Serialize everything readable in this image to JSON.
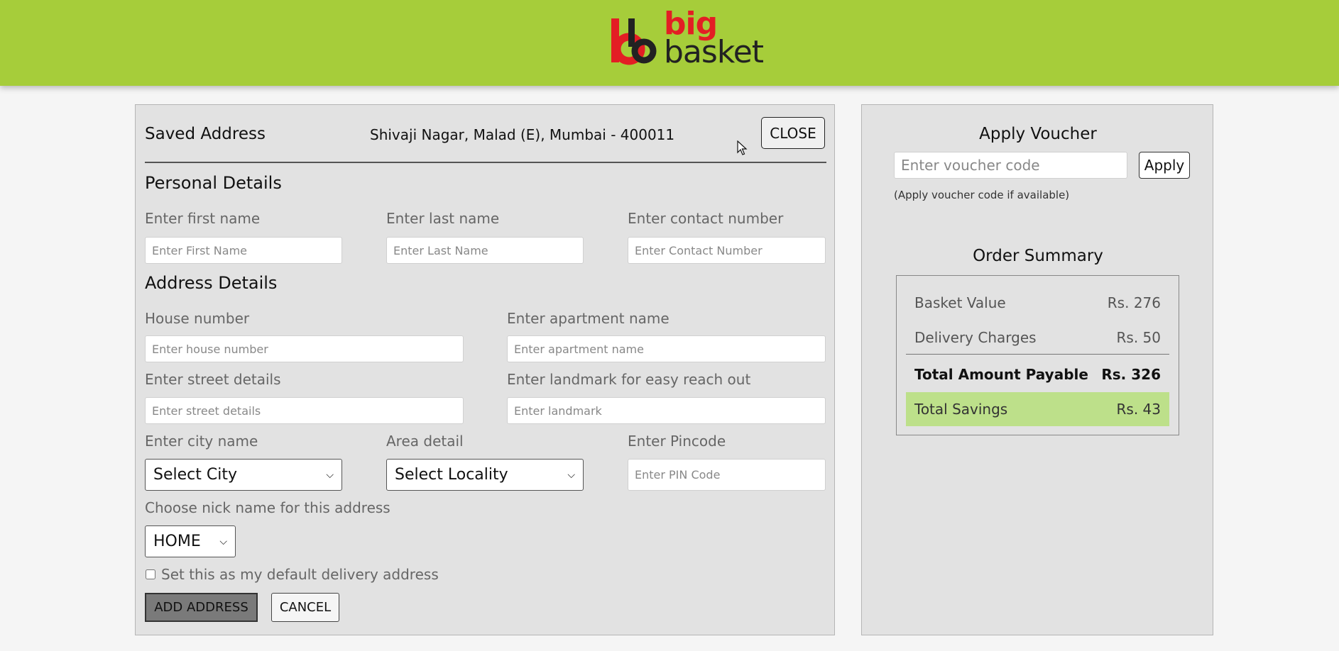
{
  "brand": {
    "logo_line1": "big",
    "logo_line2": "basket",
    "brand_red": "#e31e24",
    "header_color": "#a6cd3a"
  },
  "saved_address": {
    "heading": "Saved Address",
    "address": "Shivaji Nagar, Malad (E), Mumbai - 400011",
    "close_label": "CLOSE"
  },
  "personal": {
    "heading": "Personal Details",
    "first_name_label": "Enter first name",
    "first_name_placeholder": "Enter First Name",
    "last_name_label": "Enter last name",
    "last_name_placeholder": "Enter Last Name",
    "contact_label": "Enter contact number",
    "contact_placeholder": "Enter Contact Number"
  },
  "address": {
    "heading": "Address Details",
    "house_label": "House number",
    "house_placeholder": "Enter house number",
    "apartment_label": "Enter apartment name",
    "apartment_placeholder": "Enter apartment name",
    "street_label": "Enter street details",
    "street_placeholder": "Enter street details",
    "landmark_label": "Enter landmark for easy reach out",
    "landmark_placeholder": "Enter landmark",
    "city_label": "Enter city name",
    "city_selected": "Select City",
    "area_label": "Area detail",
    "area_selected": "Select Locality",
    "pincode_label": "Enter Pincode",
    "pincode_placeholder": "Enter PIN Code",
    "nickname_label": "Choose nick name for this address",
    "nickname_selected": "HOME",
    "default_checkbox_label": "Set this as my default delivery address",
    "default_checked": false,
    "add_label": "ADD ADDRESS",
    "cancel_label": "CANCEL"
  },
  "voucher": {
    "heading": "Apply Voucher",
    "placeholder": "Enter voucher code",
    "apply_label": "Apply",
    "note": "(Apply voucher code if available)"
  },
  "order_summary": {
    "heading": "Order Summary",
    "rows": [
      {
        "label": "Basket Value",
        "value": "Rs. 276"
      },
      {
        "label": "Delivery Charges",
        "value": "Rs. 50"
      }
    ],
    "total": {
      "label": "Total Amount Payable",
      "value": "Rs. 326"
    },
    "savings": {
      "label": "Total Savings",
      "value": "Rs. 43",
      "color": "#bde08a"
    }
  },
  "icons": {
    "dropdown": "chevron-down-icon",
    "cursor": "mouse-pointer-icon"
  }
}
